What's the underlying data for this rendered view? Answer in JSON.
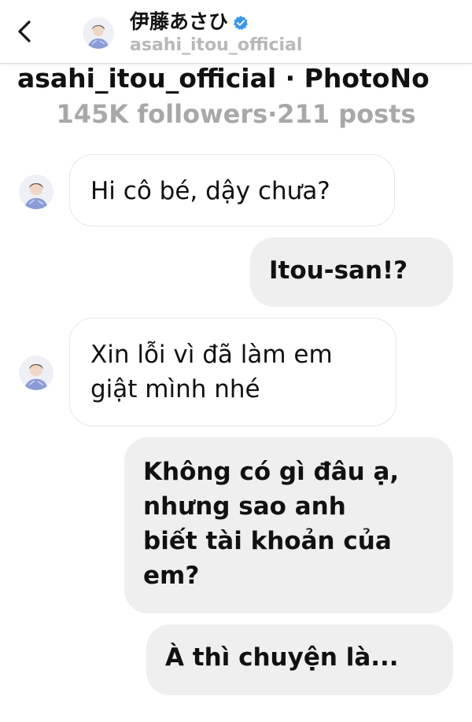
{
  "header": {
    "display_name": "伊藤あさひ",
    "username": "asahi_itou_official",
    "back_icon": "chevron-left-icon",
    "verified_icon": "verified-badge-icon",
    "verified_color": "#3897f0"
  },
  "profile": {
    "title_line": "asahi_itou_official · PhotoNo",
    "stats_line": "145K followers·211 posts"
  },
  "messages": [
    {
      "sender": "them",
      "lines": [
        "Hi cô bé, dậy chưa?"
      ]
    },
    {
      "sender": "me",
      "lines": [
        "Itou-san!?"
      ]
    },
    {
      "sender": "them",
      "lines": [
        "Xin lỗi vì đã làm em",
        "giật mình nhé"
      ]
    },
    {
      "sender": "me",
      "lines": [
        "Không có gì đâu ạ,",
        "nhưng sao anh",
        "biết tài khoản của",
        "em?"
      ]
    },
    {
      "sender": "me",
      "lines": [
        "À thì chuyện là..."
      ]
    }
  ],
  "colors": {
    "incoming_bubble": "#ffffff",
    "outgoing_bubble": "#efefef",
    "muted_text": "#a8a8a8"
  }
}
